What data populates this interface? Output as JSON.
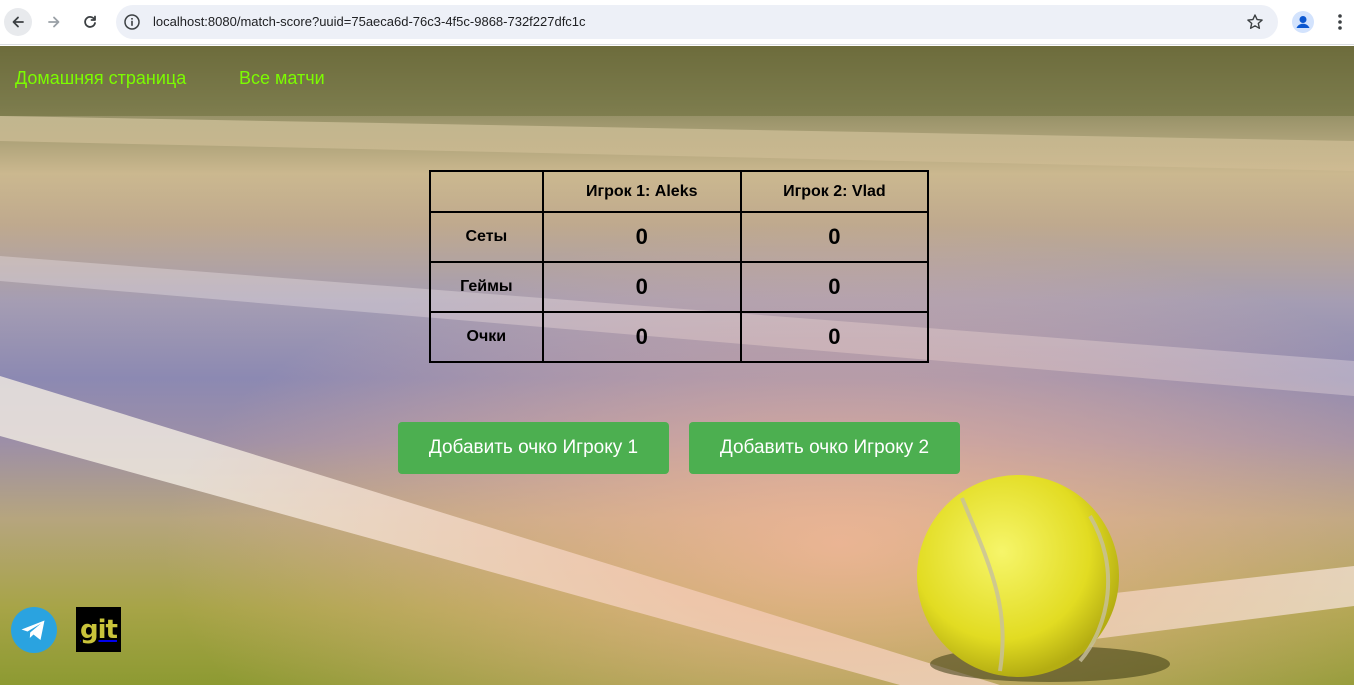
{
  "browser": {
    "url": "localhost:8080/match-score?uuid=75aeca6d-76c3-4f5c-9868-732f227dfc1c",
    "icons": [
      "back-icon",
      "forward-icon",
      "reload-icon",
      "info-icon",
      "bookmark-star-icon",
      "profile-icon",
      "menu-icon"
    ]
  },
  "nav": {
    "home": "Домашняя страница",
    "matches": "Все матчи",
    "color": "#7cfc00"
  },
  "score": {
    "header": [
      "",
      "Игрок 1: Aleks",
      "Игрок 2: Vlad"
    ],
    "rows": [
      {
        "label": "Сеты",
        "p1": "0",
        "p2": "0"
      },
      {
        "label": "Геймы",
        "p1": "0",
        "p2": "0"
      },
      {
        "label": "Очки",
        "p1": "0",
        "p2": "0"
      }
    ]
  },
  "actions": {
    "add_point_p1": "Добавить очко Игроку 1",
    "add_point_p2": "Добавить очко Игроку 2",
    "button_color": "#4caf50"
  },
  "social": {
    "telegram": "telegram-icon",
    "git_label": "git"
  }
}
